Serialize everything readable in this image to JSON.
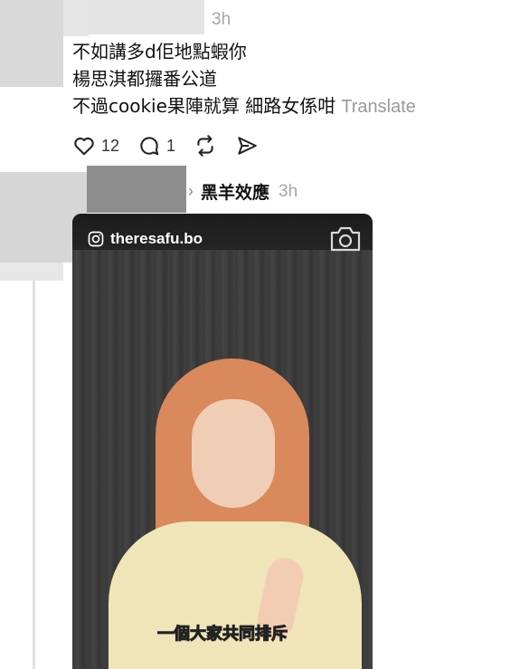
{
  "top_post": {
    "time": "3h",
    "lines": [
      "不如講多d佢地點蝦你",
      "楊思淇都攞番公道",
      "不過cookie果陣就算 細路女係咁"
    ],
    "translate_label": "Translate",
    "likes": "12",
    "comments": "1"
  },
  "reply": {
    "username": "黑羊效應",
    "time": "3h"
  },
  "media": {
    "handle": "theresafu.bo",
    "subtitle": "一個大家共同排斥"
  },
  "colors": {
    "muted": "#a6a6a6",
    "subtitle": "#ffe135"
  },
  "icons": [
    "heart-icon",
    "comment-icon",
    "repost-icon",
    "share-icon",
    "chevron-right-icon",
    "instagram-icon",
    "camera-icon"
  ]
}
